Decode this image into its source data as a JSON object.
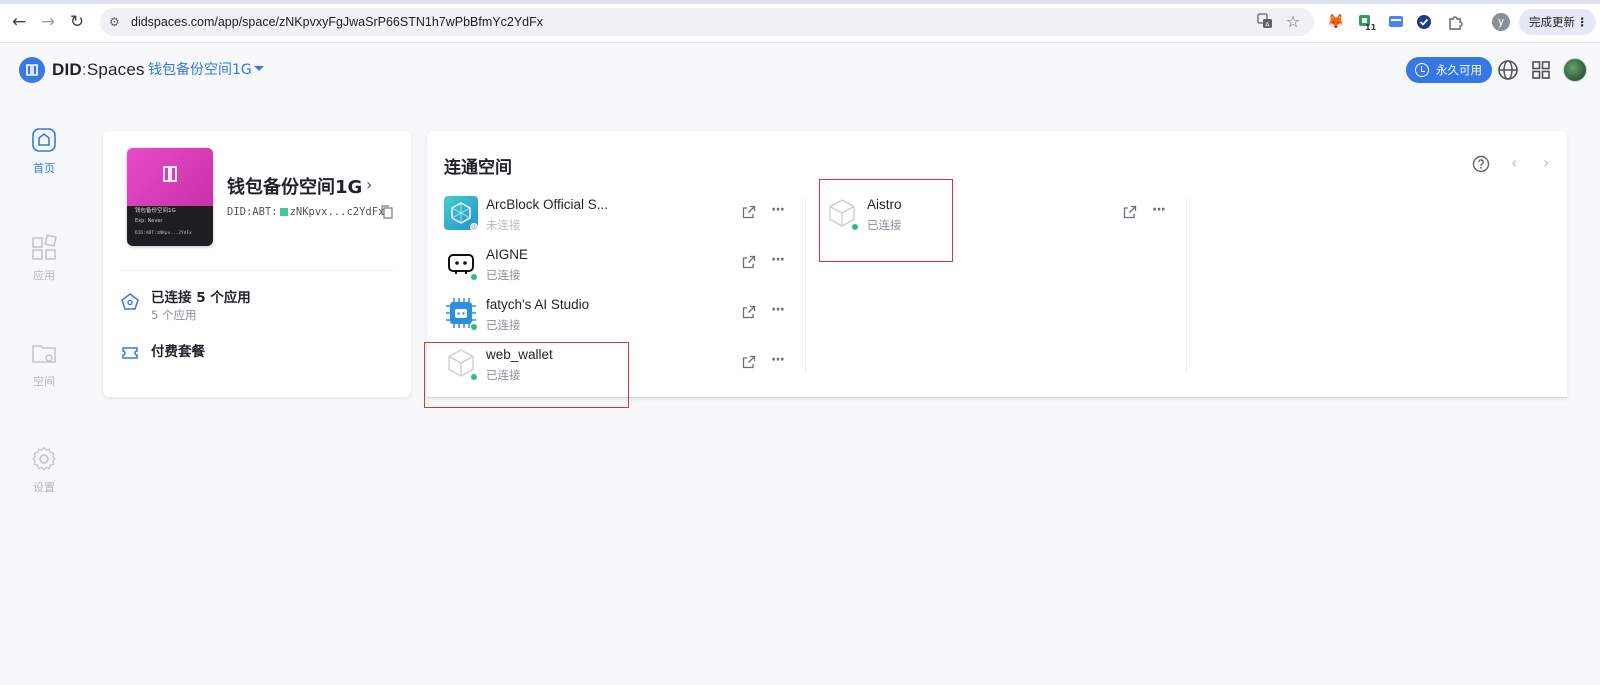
{
  "browser": {
    "back_icon": "←",
    "forward_icon": "→",
    "reload_icon": "↻",
    "url": "didspaces.com/app/space/zNKpvxyFgJwaSrP66STN1h7wPbBfmYc2YdFx",
    "update_label": "完成更新",
    "profile_initial": "y",
    "extension_badge": "11"
  },
  "header": {
    "brand_did": "DID",
    "brand_sep": ":",
    "brand_spaces": "Spaces",
    "space_selector": "钱包备份空间1G",
    "forever_label": "永久可用"
  },
  "rail": {
    "items": [
      {
        "label": "首页",
        "icon": "home-icon",
        "active": true
      },
      {
        "label": "应用",
        "icon": "apps-icon",
        "active": false
      },
      {
        "label": "空间",
        "icon": "folder-icon",
        "active": false
      },
      {
        "label": "设置",
        "icon": "gear-icon",
        "active": false
      }
    ]
  },
  "space_card": {
    "name": "钱包备份空间1G",
    "did_prefix": "DID:ABT:",
    "did_short": "zNKpvx...c2YdFx",
    "thumb_line1": "钱包备份空间1G",
    "thumb_exp": "Exp: Never",
    "thumb_did": "DID:ABT:zNKpv...2YdFx",
    "connected_title": "已连接 5 个应用",
    "connected_sub": "5 个应用",
    "plan_label": "付费套餐"
  },
  "connected_spaces": {
    "title": "连通空间",
    "apps": [
      {
        "name": "ArcBlock Official S...",
        "status": "未连接"
      },
      {
        "name": "AIGNE",
        "status": "已连接"
      },
      {
        "name": "fatych's AI Studio",
        "status": "已连接"
      },
      {
        "name": "web_wallet",
        "status": "已连接"
      },
      {
        "name": "Aistro",
        "status": "已连接"
      }
    ]
  },
  "colors": {
    "accent": "#3578e5",
    "connected_dot": "#2fbf71",
    "highlight_box": "#d9313c",
    "thumb_pink": "#e84bc8"
  }
}
